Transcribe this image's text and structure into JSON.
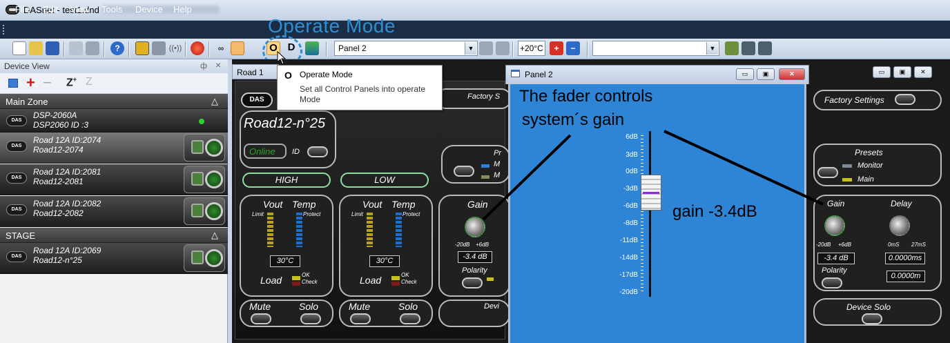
{
  "window": {
    "title": "DASnet - test1.dnd"
  },
  "menu": [
    "File",
    "Edit",
    "View",
    "Tools",
    "Device",
    "Help"
  ],
  "toolbar": {
    "panel_combo": "Panel 2",
    "temp_combo": "+20°C",
    "operate_button": "O",
    "design_button": "D",
    "icons": [
      "new-icon",
      "open-icon",
      "save-icon",
      "copy-icon",
      "paste-icon",
      "help-icon",
      "network-icon",
      "print-icon",
      "broadcast-icon",
      "record-icon",
      "link-icon",
      "users-icon",
      "operate-icon",
      "design-icon",
      "monitor-icon",
      "grid-icon",
      "grid2-icon",
      "temp-up-icon",
      "temp-down-icon",
      "fx-icon",
      "fx2-icon",
      "fx3-icon"
    ]
  },
  "annotations": {
    "operate_mode": "Operate Mode",
    "fader_line1": "The fader controls",
    "fader_line2": "system´s gain",
    "gain_value": "gain -3.4dB"
  },
  "device_view": {
    "header": "Device View",
    "pin": "ф",
    "close": "×",
    "tools": [
      "list-icon",
      "add-icon",
      "remove-icon",
      "zoom-icon",
      "zoom-out-icon"
    ],
    "zones": [
      {
        "name": "Main Zone",
        "devices": [
          {
            "l1": "DSP-2060A",
            "l2": "DSP2060  ID :3",
            "type": "dsp"
          },
          {
            "l1": "Road 12A  ID:2074",
            "l2": "Road12-2074",
            "type": "speaker",
            "selected": true
          },
          {
            "l1": "Road 12A  ID:2081",
            "l2": "Road12-2081",
            "type": "speaker"
          },
          {
            "l1": "Road 12A  ID:2082",
            "l2": "Road12-2082",
            "type": "speaker"
          }
        ]
      },
      {
        "name": "STAGE",
        "devices": [
          {
            "l1": "Road 12A  ID:2069",
            "l2": "Road12-n°25",
            "type": "speaker"
          }
        ]
      }
    ]
  },
  "tab": {
    "label": "Road 1"
  },
  "tooltip": {
    "icon": "O",
    "title": "Operate Mode",
    "description": "Set all Control Panels into operate Mode"
  },
  "control_panel": {
    "device_name": "Road12-n°25",
    "status": "Online",
    "id_label": "ID",
    "high": "HIGH",
    "low": "LOW",
    "vout": "Vout",
    "temp": "Temp",
    "limit": "Limit",
    "protect": "Protect",
    "temp_value": "30°C",
    "load": "Load",
    "ok": "OK",
    "check": "Check",
    "mute": "Mute",
    "solo": "Solo",
    "gain": "Gain",
    "gain_min": "-20dB",
    "gain_max": "+6dB",
    "gain_value": "-3.4 dB",
    "polarity": "Polarity",
    "factory": "Factory S",
    "presets_short": "Pr",
    "monitor_short": "M",
    "main_short": "M",
    "device_short": "Devi",
    "logo": "DAS"
  },
  "panel2": {
    "title": "Panel 2",
    "scale": [
      "6dB",
      "3dB",
      "0dB",
      "-3dB",
      "-6dB",
      "-8dB",
      "-11dB",
      "-14dB",
      "-17dB",
      "-20dB"
    ],
    "fader_value_db": -3.4
  },
  "right_panel": {
    "factory": "Factory Settings",
    "presets": "Presets",
    "monitor": "Monitor",
    "main": "Main",
    "gain": "Gain",
    "delay": "Delay",
    "gain_min": "-20dB",
    "gain_max": "+6dB",
    "delay_min": "0mS",
    "delay_max": "27mS",
    "gain_value": "-3.4 dB",
    "delay_ms": "0.0000ms",
    "polarity": "Polarity",
    "delay_m": "0.0000m",
    "device_solo": "Device Solo"
  }
}
